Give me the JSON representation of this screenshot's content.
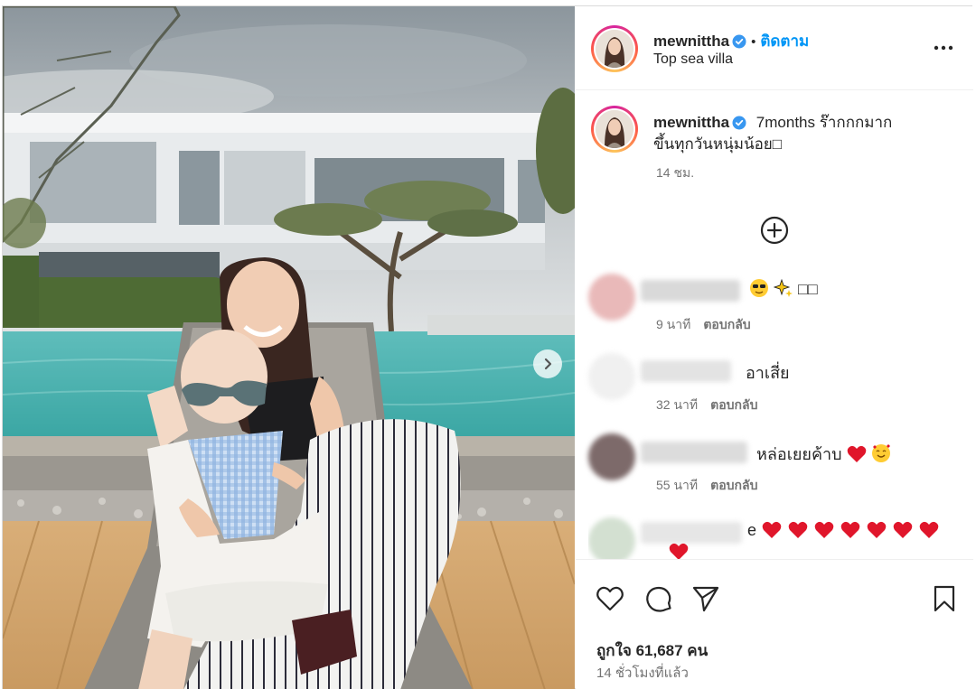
{
  "header": {
    "username": "mewnittha",
    "separator": "•",
    "follow_label": "ติดตาม",
    "location": "Top sea villa"
  },
  "caption": {
    "username": "mewnittha",
    "text_line1": "7months ร๊ากกกมาก",
    "text_line2": "ขึ้นทุกวันหนุ่มน้อย□",
    "time": "14 ชม."
  },
  "comments": [
    {
      "text": "□□",
      "time": "9 นาที",
      "reply": "ตอบกลับ"
    },
    {
      "text": "อาเสี่ย",
      "time": "32 นาที",
      "reply": "ตอบกลับ"
    },
    {
      "text": "หล่อเยยค้าบ",
      "time": "55 นาที",
      "reply": "ตอบกลับ"
    },
    {
      "text": "e"
    }
  ],
  "footer": {
    "likes": "ถูกใจ 61,687 คน",
    "posted": "14 ชั่วโมงที่แล้ว"
  },
  "colors": {
    "accent": "#0095f6",
    "verified": "#3897f0",
    "heart": "#e0162b"
  },
  "icons": [
    "verified-icon",
    "more-options-icon",
    "add-comment-icon",
    "like-icon",
    "comment-icon",
    "share-icon",
    "save-icon",
    "next-arrow-icon"
  ]
}
